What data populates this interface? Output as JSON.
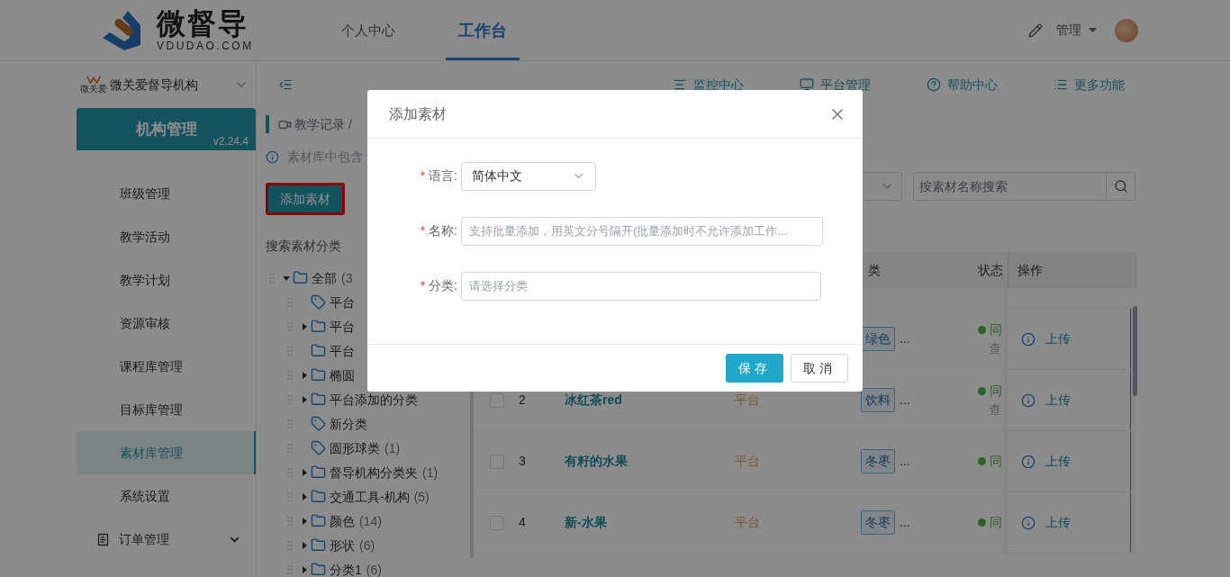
{
  "header": {
    "logo_text": "微督导",
    "logo_subtext": "VDUDAO.COM",
    "nav": [
      {
        "label": "个人中心",
        "selected": false
      },
      {
        "label": "工作台",
        "selected": true
      }
    ],
    "user": "管理"
  },
  "sidebar": {
    "org": "微关爱督导机构",
    "org_logo_text": "微关爱",
    "card": {
      "title": "机构管理",
      "version": "v2.24.4"
    },
    "items": [
      {
        "label": "班级管理",
        "kind": "item",
        "selected": false
      },
      {
        "label": "教学活动",
        "kind": "item",
        "selected": false
      },
      {
        "label": "教学计划",
        "kind": "item",
        "selected": false
      },
      {
        "label": "资源审核",
        "kind": "item",
        "selected": false
      },
      {
        "label": "课程库管理",
        "kind": "item",
        "selected": false
      },
      {
        "label": "目标库管理",
        "kind": "item",
        "selected": false
      },
      {
        "label": "素材库管理",
        "kind": "item",
        "selected": true
      },
      {
        "label": "系统设置",
        "kind": "item",
        "selected": false
      },
      {
        "label": "订单管理",
        "kind": "group",
        "selected": false
      }
    ]
  },
  "toolbar": {
    "links": [
      {
        "label": "监控中心",
        "kind": "monitor"
      },
      {
        "label": "平台管理",
        "kind": "screen"
      },
      {
        "label": "帮助中心",
        "kind": "help"
      },
      {
        "label": "更多功能",
        "kind": "list"
      }
    ]
  },
  "left_panel": {
    "breadcrumb": "教学记录 /",
    "notice": "素材库中包含",
    "add_button": {
      "label": "添加素材",
      "highlighted": true
    },
    "tree_title": "搜索素材分类",
    "tree": [
      {
        "label": "全部",
        "count": "(3",
        "kind": "folder",
        "expanded": true,
        "children": [
          {
            "label": "平台",
            "kind": "tag"
          },
          {
            "label": "平台",
            "kind": "folder",
            "expanded": false
          },
          {
            "label": "平台",
            "kind": "folder"
          },
          {
            "label": "椭圆",
            "kind": "folder",
            "expanded": false
          },
          {
            "label": "平台添加的分类",
            "kind": "folder",
            "expanded": false
          },
          {
            "label": "新分类",
            "kind": "tag"
          },
          {
            "label": "圆形球类",
            "count": "(1)",
            "kind": "tag"
          },
          {
            "label": "督导机构分类夹",
            "count": "(1)",
            "kind": "folder",
            "expanded": false
          },
          {
            "label": "交通工具-机构",
            "count": "(5)",
            "kind": "folder",
            "expanded": false
          },
          {
            "label": "颜色",
            "count": "(14)",
            "kind": "folder",
            "expanded": false
          },
          {
            "label": "形状",
            "count": "(6)",
            "kind": "folder",
            "expanded": false
          },
          {
            "label": "分类1",
            "count": "(6)",
            "kind": "folder",
            "expanded": false
          }
        ]
      }
    ]
  },
  "right_panel": {
    "search_placeholder": "按素材名称搜索",
    "table": {
      "columns": [
        "类",
        "状态",
        "操作"
      ],
      "rows": [
        {
          "tag": "绿色",
          "more": "...",
          "status": "同",
          "status_note": "查",
          "action": "上传"
        },
        {
          "checked": false,
          "index": "2",
          "name": "冰红茶red",
          "source": "平台",
          "tag": "饮料",
          "more": "...",
          "status": "同",
          "status_note": "查",
          "action": "上传"
        },
        {
          "checked": false,
          "index": "3",
          "name": "有籽的水果",
          "source": "平台",
          "tag": "冬枣",
          "more": "...",
          "status": "同",
          "action": "上传"
        },
        {
          "checked": false,
          "index": "4",
          "name": "新-水果",
          "source": "平台",
          "tag": "冬枣",
          "more": "...",
          "status": "同",
          "action": "上传"
        }
      ]
    }
  },
  "modal": {
    "title": "添加素材",
    "fields": [
      {
        "label": "语言:",
        "required_mark": "*",
        "kind": "select",
        "value": "简体中文"
      },
      {
        "label": "名称:",
        "required_mark": "*",
        "kind": "input",
        "placeholder": "支持批量添加，用英文分号隔开(批量添加时不允许添加工作..."
      },
      {
        "label": "分类:",
        "required_mark": "*",
        "kind": "input",
        "placeholder": "请选择分类"
      }
    ],
    "buttons": [
      {
        "label": "保存",
        "kind": "primary"
      },
      {
        "label": "取消",
        "kind": "default"
      }
    ]
  }
}
